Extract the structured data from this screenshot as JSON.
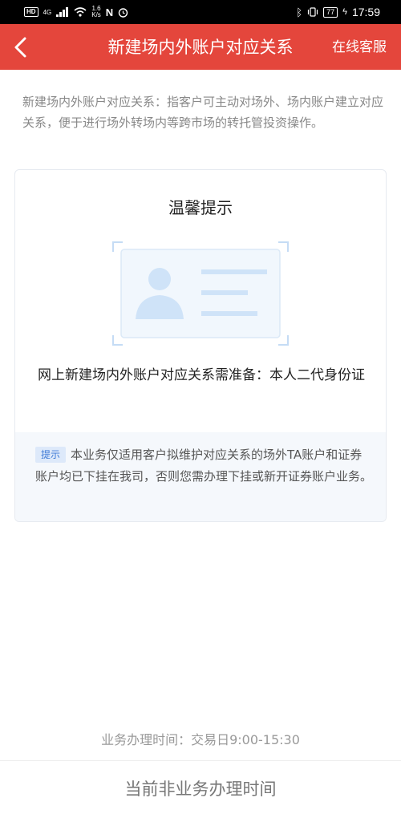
{
  "status_bar": {
    "network": "HD",
    "signal_gen": "4G",
    "speed_value": "1.6",
    "speed_unit": "K/s",
    "battery": "77",
    "time": "17:59"
  },
  "header": {
    "title": "新建场内外账户对应关系",
    "service_link": "在线客服"
  },
  "intro": "新建场内外账户对应关系：指客户可主动对场外、场内账户建立对应关系，便于进行场外转场内等跨市场的转托管投资操作。",
  "card": {
    "title": "温馨提示",
    "requirement": "网上新建场内外账户对应关系需准备：本人二代身份证",
    "tip_badge": "提示",
    "tip_text": "本业务仅适用客户拟维护对应关系的场外TA账户和证券账户均已下挂在我司，否则您需办理下挂或新开证券账户业务。"
  },
  "business_hours": "业务办理时间：交易日9:00-15:30",
  "bottom_button": "当前非业务办理时间",
  "colors": {
    "header_bg": "#e4463c",
    "illustration": "#cfe3f8",
    "tip_badge_text": "#3e7ad6"
  }
}
